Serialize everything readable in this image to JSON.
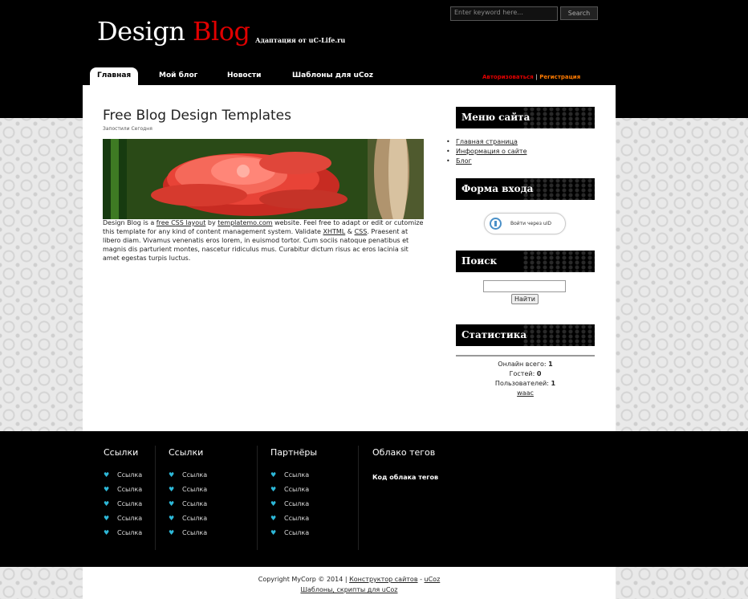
{
  "header": {
    "logo_part1": "Design",
    "logo_part2": "Blog",
    "tagline": "Адаптация от uC-Life.ru",
    "search_placeholder": "Enter keyword here...",
    "search_button": "Search",
    "nav": [
      "Главная",
      "Мой блог",
      "Новости",
      "Шаблоны для uCoz"
    ],
    "auth_login": "Авторизоваться",
    "auth_sep": "|",
    "auth_register": "Регистрация"
  },
  "post": {
    "title": "Free Blog Design Templates",
    "meta": "Запостили Сегодня",
    "body_1": "Design Blog is a ",
    "link_free_css": "free CSS layout",
    "body_2": " by ",
    "link_templatemo": "templatemo.com",
    "body_3": " website. Feel free to adapt or edit or cutomize this template for any kind of content management system. Validate ",
    "link_xhtml": "XHTML",
    "body_4": " & ",
    "link_css": "CSS",
    "body_5": ". Praesent at libero diam. Vivamus venenatis eros lorem, in euismod tortor. Cum sociis natoque penatibus et magnis dis parturient montes, nascetur ridiculus mus. Curabitur dictum risus ac eros lacinia sit amet egestas turpis luctus."
  },
  "sidebar": {
    "menu_title": "Меню сайта",
    "menu_items": [
      "Главная страница",
      "Информация о сайте",
      "Блог"
    ],
    "login_title": "Форма входа",
    "uid_label": "Войти через uID",
    "search_title": "Поиск",
    "search_button": "Найти",
    "stats_title": "Статистика",
    "stats_online_label": "Онлайн всего:",
    "stats_online": "1",
    "stats_guests_label": "Гостей:",
    "stats_guests": "0",
    "stats_users_label": "Пользователей:",
    "stats_users": "1",
    "stats_user_name": "waac"
  },
  "footer": {
    "col1_title": "Ссылки",
    "col2_title": "Ссылки",
    "col3_title": "Партнёры",
    "col4_title": "Облако тегов",
    "link_label": "Ссылка",
    "tags_text": "Код облака тегов",
    "copyright_text": "Copyright MyCorp © 2014 | ",
    "copyright_link1": "Конструктор сайтов",
    "copyright_dash": " - ",
    "copyright_link2": "uCoz",
    "copyright_link3": "Шаблоны, скрипты для uCoz"
  }
}
